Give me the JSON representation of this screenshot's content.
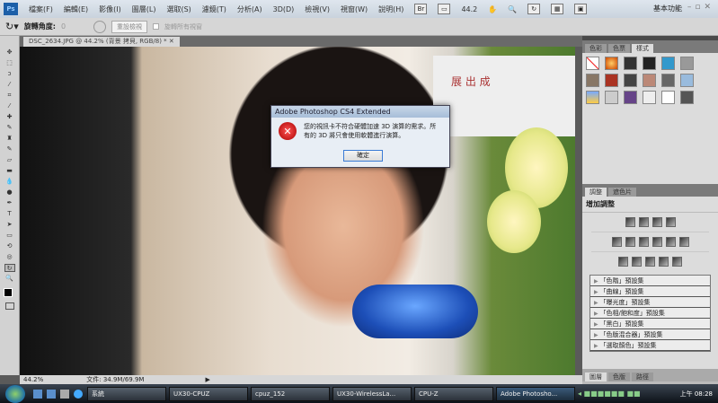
{
  "app": {
    "logo": "Ps",
    "menu": [
      "檔案(F)",
      "編輯(E)",
      "影像(I)",
      "圖層(L)",
      "選取(S)",
      "濾鏡(T)",
      "分析(A)",
      "3D(D)",
      "檢視(V)",
      "視窗(W)",
      "說明(H)"
    ],
    "zoom_select": "44.2",
    "workspace": "基本功能"
  },
  "options": {
    "rotate_label": "旋轉角度:",
    "rotate_value": "0",
    "reset_view": "重設檢視",
    "rotate_all": "旋轉所有視窗"
  },
  "document": {
    "tab": "DSC_2634.JPG @ 44.2% (背景 拷貝, RGB/8) *",
    "banner": "展 出 成"
  },
  "status": {
    "zoom": "44.2%",
    "doc_size": "文件: 34.9M/69.9M"
  },
  "panels": {
    "top_tabs": [
      "色彩",
      "色票",
      "樣式"
    ],
    "adj_tabs": [
      "調整",
      "遮色片"
    ],
    "adj_title": "增加調整",
    "presets": [
      "「色階」預設集",
      "「曲線」預設集",
      "「曝光度」預設集",
      "「色相/飽和度」預設集",
      "「黑白」預設集",
      "「色版混合器」預設集",
      "「選取顏色」預設集"
    ],
    "layer_tabs": [
      "圖層",
      "色版",
      "路徑"
    ]
  },
  "dialog": {
    "title": "Adobe Photoshop CS4 Extended",
    "message": "您的視訊卡不符合硬體加速 3D 演算的需求。所有的 3D 將只會使用軟體進行演算。",
    "ok": "確定"
  },
  "taskbar": {
    "tasks": [
      "系統",
      "UX30-CPUZ",
      "cpuz_152",
      "UX30-WirelessLa...",
      "CPU-Z",
      "Adobe Photosho..."
    ],
    "clock": "上午 08:28"
  }
}
